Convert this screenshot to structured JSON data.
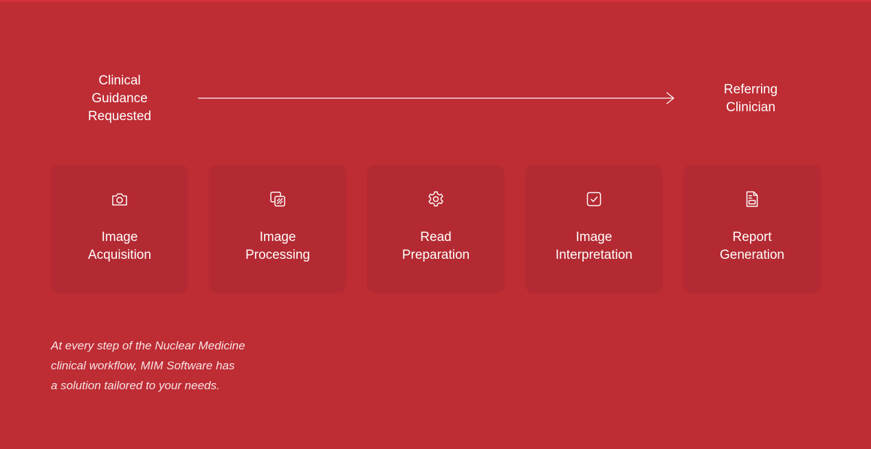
{
  "flow": {
    "start_lines": [
      "Clinical",
      "Guidance",
      "Requested"
    ],
    "end_lines": [
      "Referring",
      "Clinician"
    ]
  },
  "steps": [
    {
      "icon": "camera-icon",
      "lines": [
        "Image",
        "Acquisition"
      ]
    },
    {
      "icon": "layers-icon",
      "lines": [
        "Image",
        "Processing"
      ]
    },
    {
      "icon": "gear-icon",
      "lines": [
        "Read",
        "Preparation"
      ]
    },
    {
      "icon": "checkbox-icon",
      "lines": [
        "Image",
        "Interpretation"
      ]
    },
    {
      "icon": "document-icon",
      "lines": [
        "Report",
        "Generation"
      ]
    }
  ],
  "tagline_lines": [
    "At every step of the Nuclear Medicine",
    "clinical workflow, MIM Software has",
    "a solution tailored to your needs."
  ],
  "colors": {
    "background": "#be2c34",
    "card": "#b42a32",
    "text": "#ffffff"
  }
}
